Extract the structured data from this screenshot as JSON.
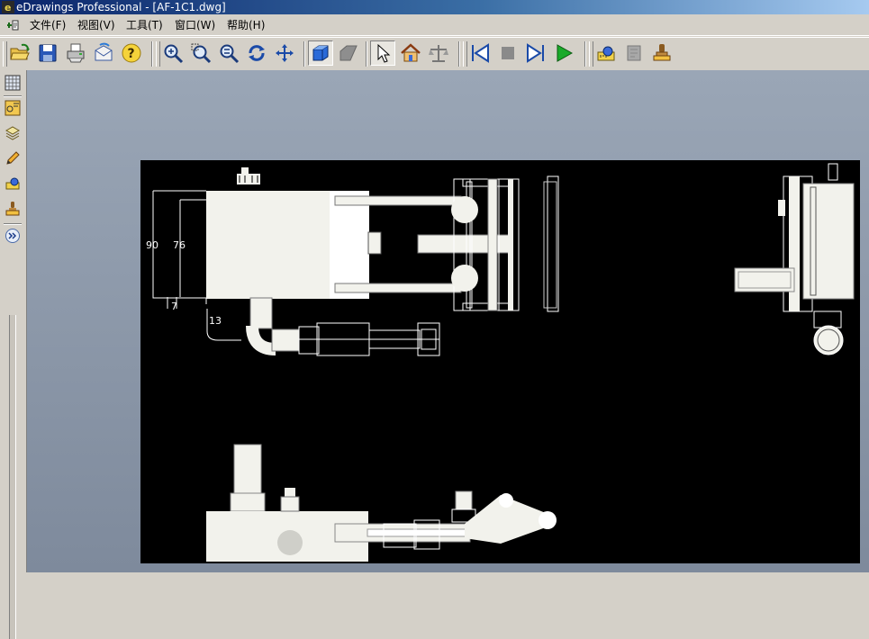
{
  "window": {
    "title": "eDrawings Professional - [AF-1C1.dwg]"
  },
  "menu": [
    {
      "label": "文件(F)"
    },
    {
      "label": "视图(V)"
    },
    {
      "label": "工具(T)"
    },
    {
      "label": "窗口(W)"
    },
    {
      "label": "帮助(H)"
    }
  ],
  "toolbar": {
    "buttons": [
      "open-icon",
      "save-icon",
      "print-icon",
      "send-mail-icon",
      "help-icon",
      "zoom-icon",
      "zoom-to-area-icon",
      "zoom-to-fit-icon",
      "rotate-icon",
      "pan-icon",
      "shaded-view-icon",
      "hidden-lines-icon",
      "select-icon",
      "home-view-icon",
      "measure-balance-icon",
      "first-frame-icon",
      "stop-icon",
      "next-frame-icon",
      "play-icon",
      "measure-icon",
      "markup-icon",
      "stamp-icon"
    ]
  },
  "left_toolbar": {
    "buttons": [
      "sheet-format-icon",
      "sheets-icon",
      "layers-icon",
      "markup-pen-icon",
      "measure-icon",
      "stamp-icon",
      "expand-panel-icon"
    ]
  },
  "drawing": {
    "dimensions": [
      "90",
      "76",
      "7",
      "13"
    ],
    "colors": {
      "background": "#000000",
      "lines": "#ffffff",
      "part": "#f2f2ec"
    }
  }
}
